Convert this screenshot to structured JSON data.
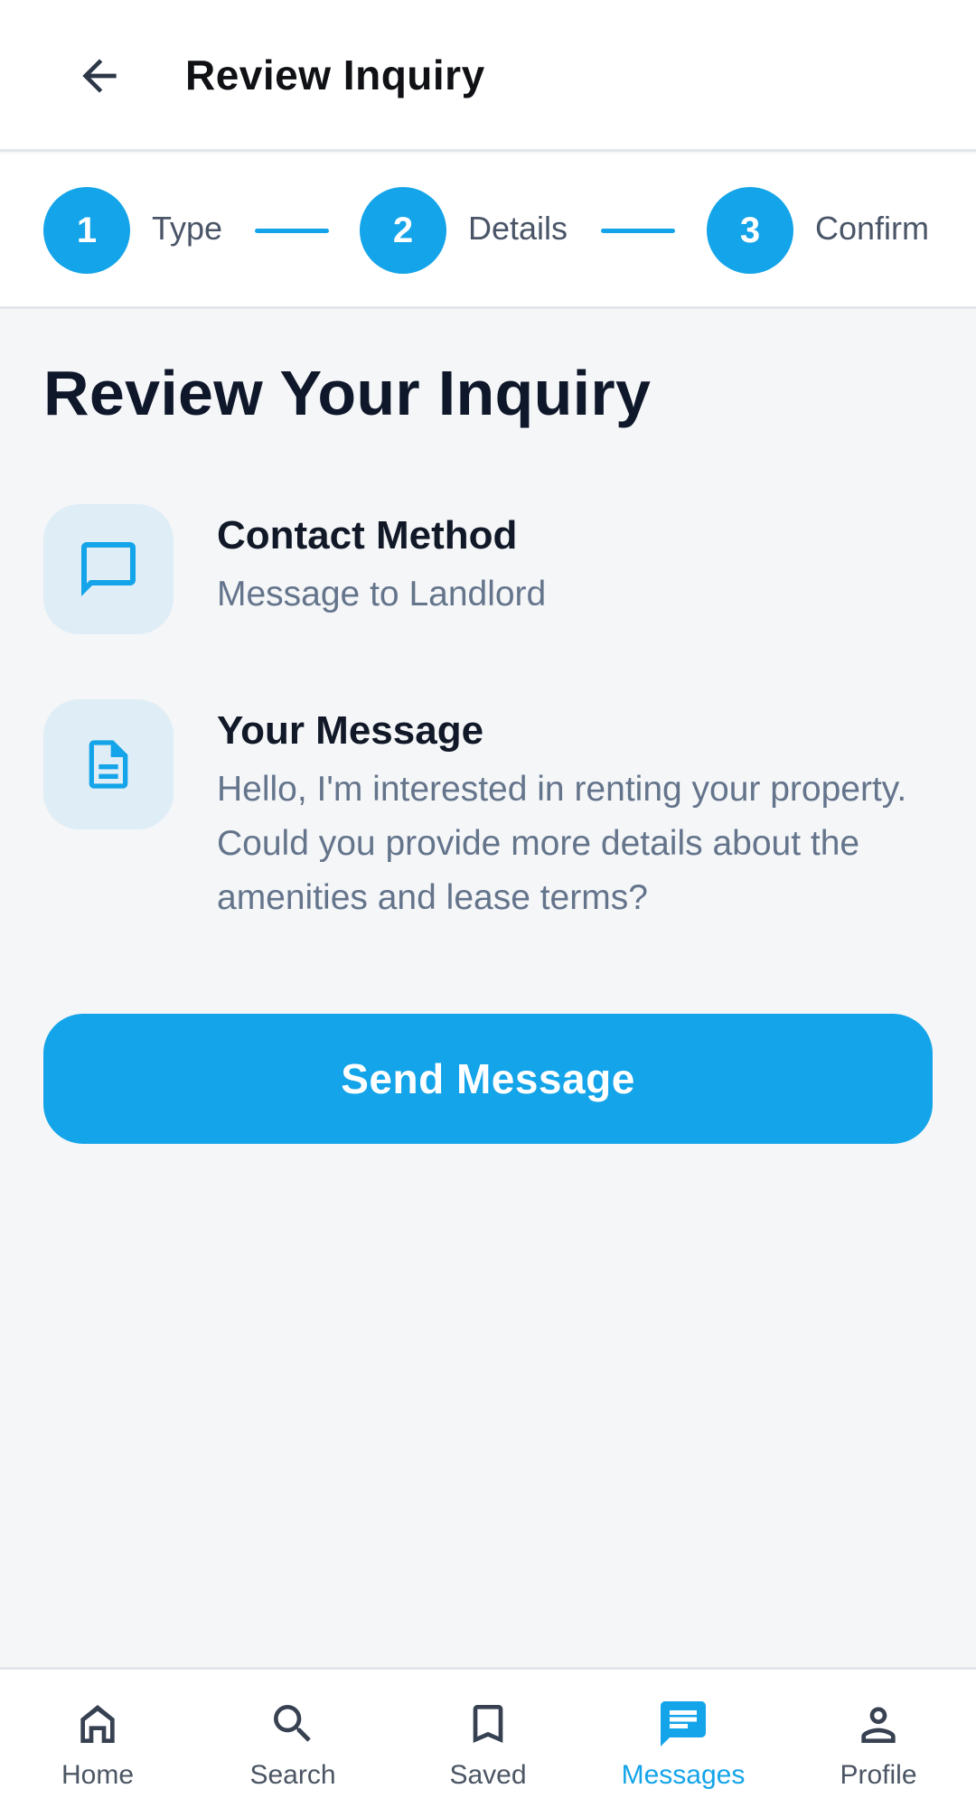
{
  "header": {
    "title": "Review Inquiry",
    "back_icon": "arrow-left-icon"
  },
  "stepper": {
    "steps": [
      {
        "number": "1",
        "label": "Type"
      },
      {
        "number": "2",
        "label": "Details"
      },
      {
        "number": "3",
        "label": "Confirm"
      }
    ]
  },
  "main": {
    "heading": "Review Your Inquiry",
    "items": [
      {
        "icon": "chat-bubble-icon",
        "title": "Contact Method",
        "value": "Message to Landlord"
      },
      {
        "icon": "document-icon",
        "title": "Your Message",
        "value": "Hello, I'm interested in renting your property. Could you provide more details about the amenities and lease terms?"
      }
    ],
    "send_label": "Send Message"
  },
  "bottom_nav": {
    "items": [
      {
        "label": "Home",
        "icon": "home-icon",
        "active": false
      },
      {
        "label": "Search",
        "icon": "search-icon",
        "active": false
      },
      {
        "label": "Saved",
        "icon": "bookmark-icon",
        "active": false
      },
      {
        "label": "Messages",
        "icon": "message-icon",
        "active": true
      },
      {
        "label": "Profile",
        "icon": "person-icon",
        "active": false
      }
    ]
  },
  "colors": {
    "accent": "#14a4e9",
    "background": "#f4f6f8",
    "tile": "#dfedf6",
    "muted_text": "#64748b"
  }
}
